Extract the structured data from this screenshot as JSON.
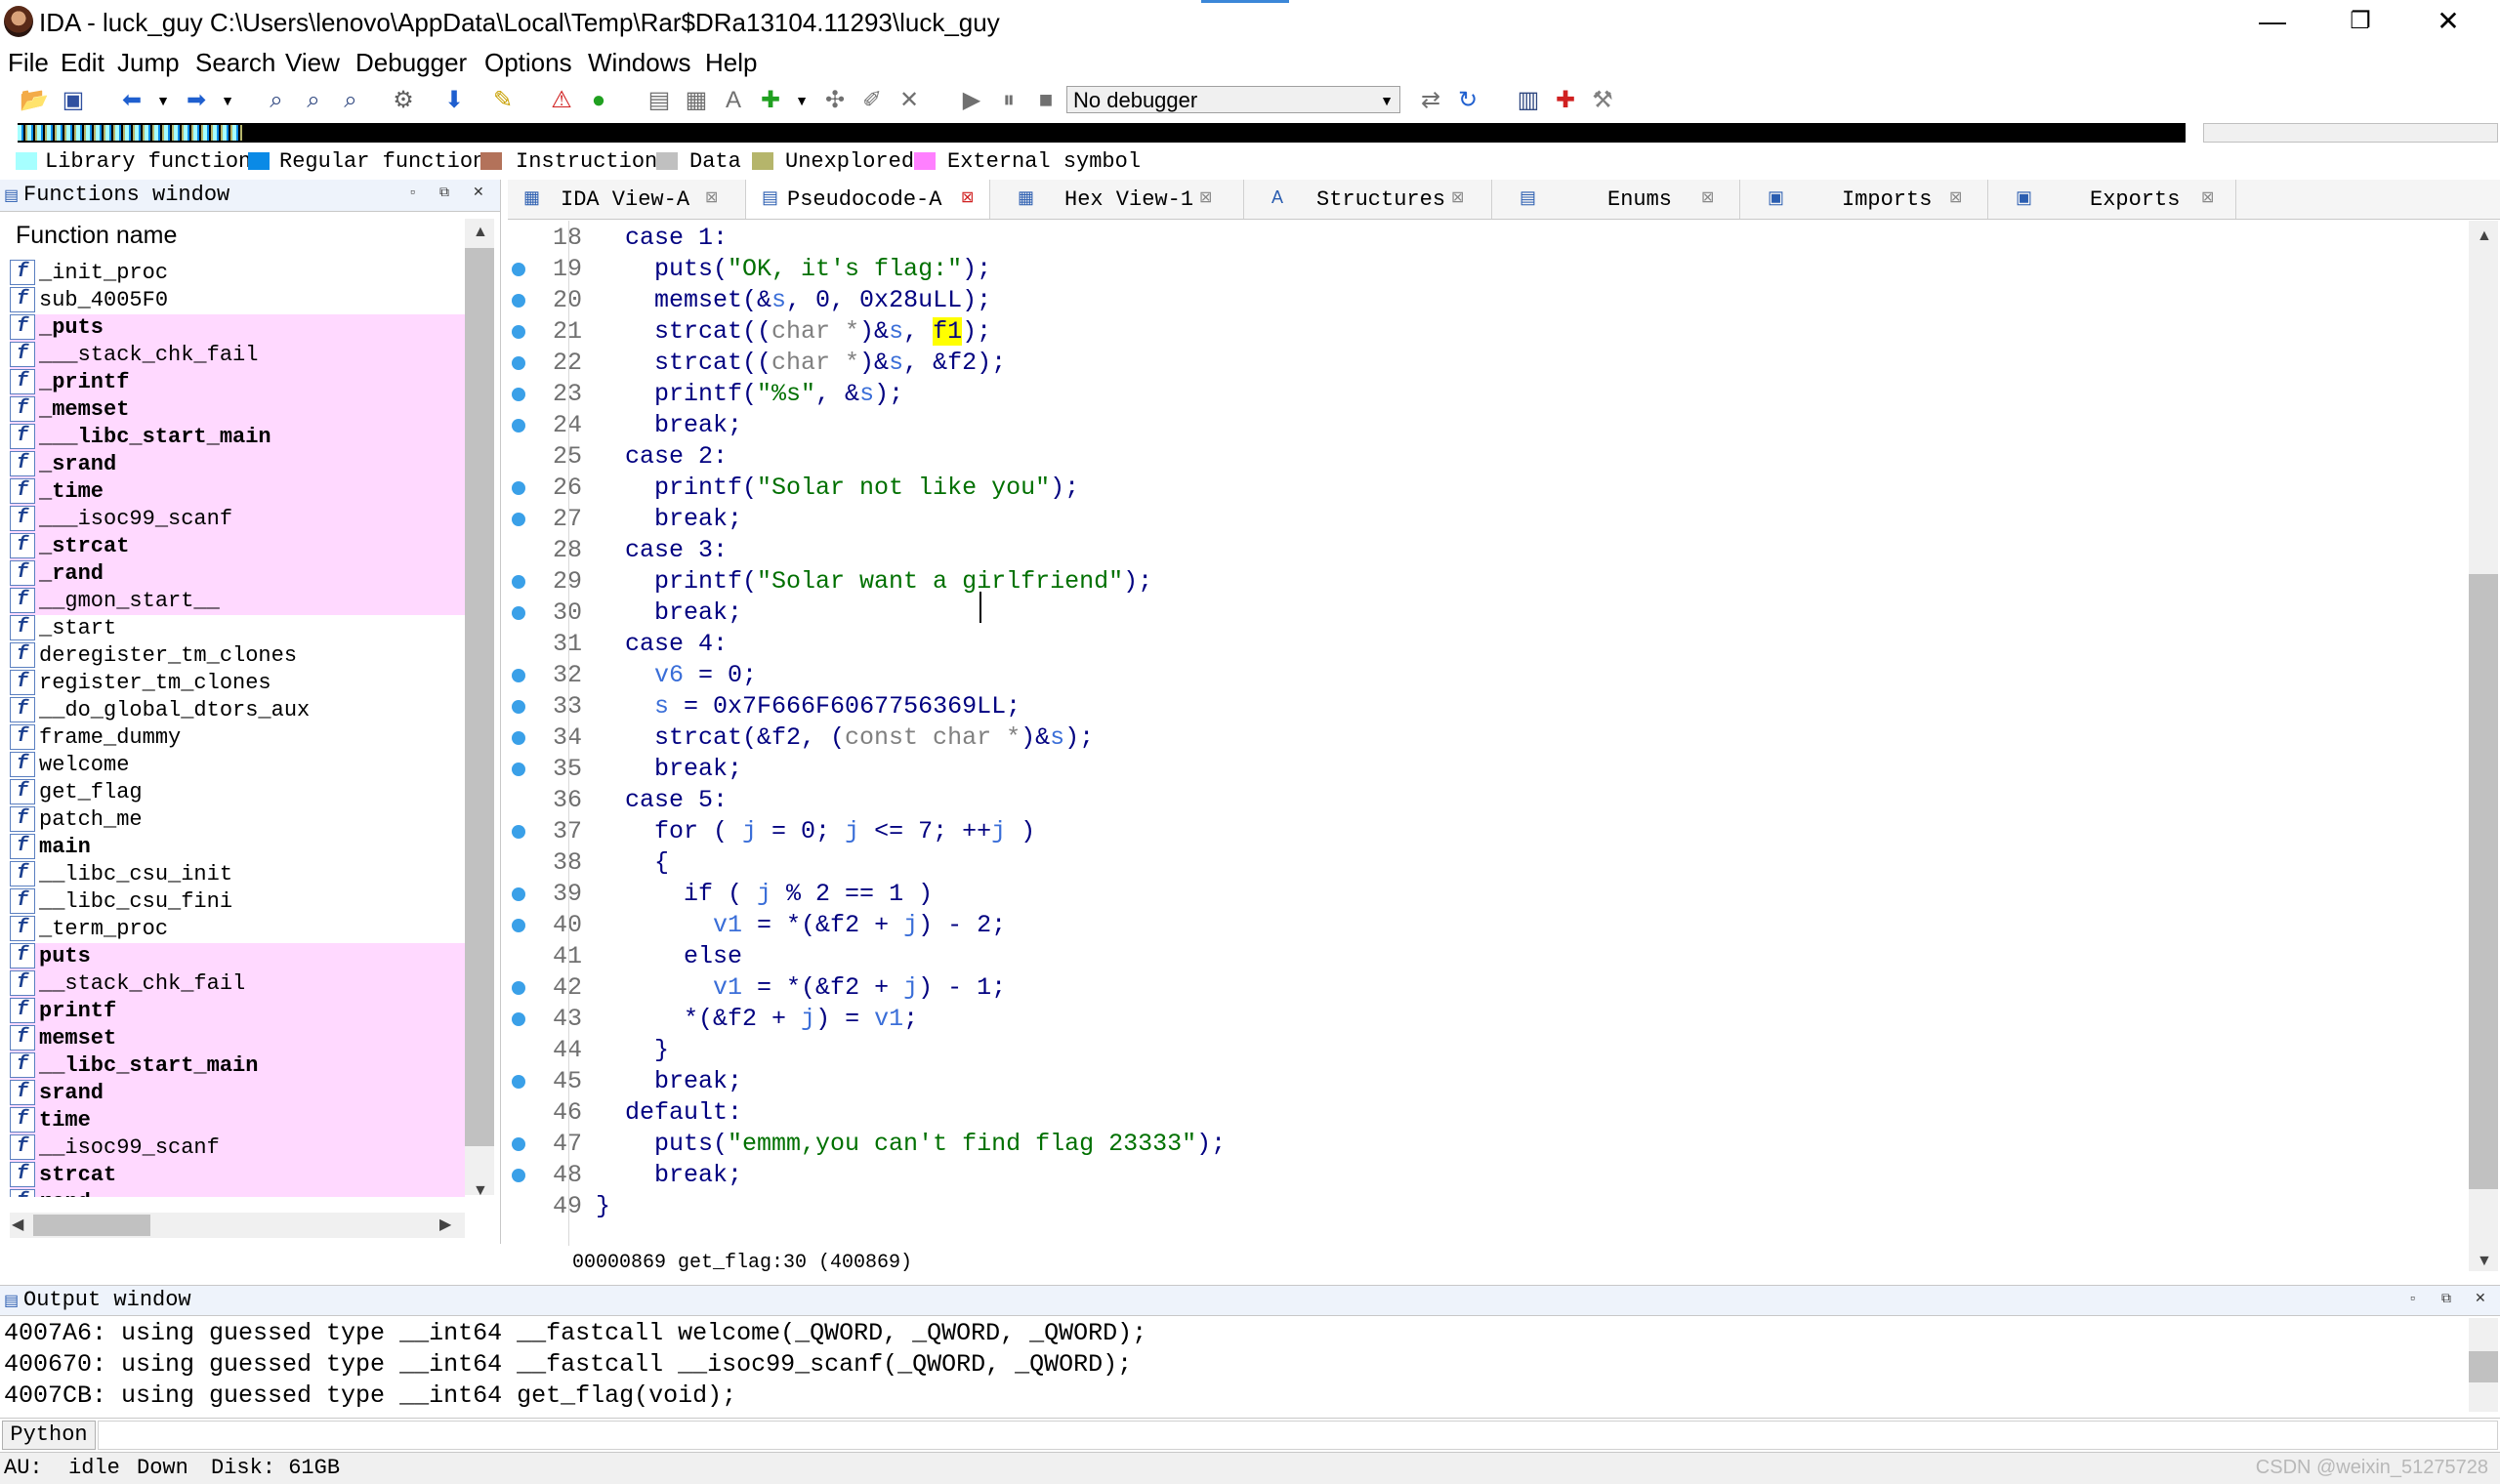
{
  "window": {
    "title": "IDA - luck_guy C:\\Users\\lenovo\\AppData\\Local\\Temp\\Rar$DRa13104.11293\\luck_guy",
    "minimize": "—",
    "maximize": "❐",
    "close": "✕"
  },
  "menu": [
    "File",
    "Edit",
    "Jump",
    "Search",
    "View",
    "Debugger",
    "Options",
    "Windows",
    "Help"
  ],
  "toolbar": {
    "debugger_select": "No debugger"
  },
  "legend": [
    {
      "label": "Library function",
      "color": "#a6ffff"
    },
    {
      "label": "Regular function",
      "color": "#0a8ae6"
    },
    {
      "label": "Instruction",
      "color": "#b3725a"
    },
    {
      "label": "Data",
      "color": "#c0c0c0"
    },
    {
      "label": "Unexplored",
      "color": "#b5b56b"
    },
    {
      "label": "External symbol",
      "color": "#ff80ff"
    }
  ],
  "functions_window": {
    "title": "Functions window",
    "header": "Function name",
    "items": [
      {
        "name": "_init_proc",
        "pink": false,
        "bold": false
      },
      {
        "name": "sub_4005F0",
        "pink": false,
        "bold": false
      },
      {
        "name": "_puts",
        "pink": true,
        "bold": true
      },
      {
        "name": "___stack_chk_fail",
        "pink": true,
        "bold": false
      },
      {
        "name": "_printf",
        "pink": true,
        "bold": true
      },
      {
        "name": "_memset",
        "pink": true,
        "bold": true
      },
      {
        "name": "___libc_start_main",
        "pink": true,
        "bold": true
      },
      {
        "name": "_srand",
        "pink": true,
        "bold": true
      },
      {
        "name": "_time",
        "pink": true,
        "bold": true
      },
      {
        "name": "___isoc99_scanf",
        "pink": true,
        "bold": false
      },
      {
        "name": "_strcat",
        "pink": true,
        "bold": true
      },
      {
        "name": "_rand",
        "pink": true,
        "bold": true
      },
      {
        "name": "__gmon_start__",
        "pink": true,
        "bold": false
      },
      {
        "name": "_start",
        "pink": false,
        "bold": false
      },
      {
        "name": "deregister_tm_clones",
        "pink": false,
        "bold": false
      },
      {
        "name": "register_tm_clones",
        "pink": false,
        "bold": false
      },
      {
        "name": "__do_global_dtors_aux",
        "pink": false,
        "bold": false
      },
      {
        "name": "frame_dummy",
        "pink": false,
        "bold": false
      },
      {
        "name": "welcome",
        "pink": false,
        "bold": false
      },
      {
        "name": "get_flag",
        "pink": false,
        "bold": false
      },
      {
        "name": "patch_me",
        "pink": false,
        "bold": false
      },
      {
        "name": "main",
        "pink": false,
        "bold": true
      },
      {
        "name": "__libc_csu_init",
        "pink": false,
        "bold": false
      },
      {
        "name": "__libc_csu_fini",
        "pink": false,
        "bold": false
      },
      {
        "name": "_term_proc",
        "pink": false,
        "bold": false
      },
      {
        "name": "puts",
        "pink": true,
        "bold": true
      },
      {
        "name": "__stack_chk_fail",
        "pink": true,
        "bold": false
      },
      {
        "name": "printf",
        "pink": true,
        "bold": true
      },
      {
        "name": "memset",
        "pink": true,
        "bold": true
      },
      {
        "name": "__libc_start_main",
        "pink": true,
        "bold": true
      },
      {
        "name": "srand",
        "pink": true,
        "bold": true
      },
      {
        "name": "time",
        "pink": true,
        "bold": true
      },
      {
        "name": "__isoc99_scanf",
        "pink": true,
        "bold": false
      },
      {
        "name": "strcat",
        "pink": true,
        "bold": true
      },
      {
        "name": "rand",
        "pink": true,
        "bold": true
      }
    ]
  },
  "tabs": [
    {
      "label": "IDA View-A",
      "active": false
    },
    {
      "label": "Pseudocode-A",
      "active": true
    },
    {
      "label": "Hex View-1",
      "active": false
    },
    {
      "label": "Structures",
      "active": false
    },
    {
      "label": "Enums",
      "active": false
    },
    {
      "label": "Imports",
      "active": false
    },
    {
      "label": "Exports",
      "active": false
    }
  ],
  "code": [
    {
      "n": "18",
      "bp": false,
      "html": "  case 1:"
    },
    {
      "n": "19",
      "bp": true,
      "html": "    puts(<span class=\"str\">\"OK, it's flag:\"</span>);"
    },
    {
      "n": "20",
      "bp": true,
      "html": "    memset(&amp;<span class=\"var\">s</span>, 0, 0x28uLL);"
    },
    {
      "n": "21",
      "bp": true,
      "html": "    strcat((<span class=\"cast\">char *</span>)&amp;<span class=\"var\">s</span>, <span class=\"hl\">f1</span>);"
    },
    {
      "n": "22",
      "bp": true,
      "html": "    strcat((<span class=\"cast\">char *</span>)&amp;<span class=\"var\">s</span>, &amp;f2);"
    },
    {
      "n": "23",
      "bp": true,
      "html": "    printf(<span class=\"str\">\"%s\"</span>, &amp;<span class=\"var\">s</span>);"
    },
    {
      "n": "24",
      "bp": true,
      "html": "    break;"
    },
    {
      "n": "25",
      "bp": false,
      "html": "  case 2:"
    },
    {
      "n": "26",
      "bp": true,
      "html": "    printf(<span class=\"str\">\"Solar not like you\"</span>);"
    },
    {
      "n": "27",
      "bp": true,
      "html": "    break;"
    },
    {
      "n": "28",
      "bp": false,
      "html": "  case 3:"
    },
    {
      "n": "29",
      "bp": true,
      "html": "    printf(<span class=\"str\">\"Solar want a girlfriend\"</span>);"
    },
    {
      "n": "30",
      "bp": true,
      "html": "    break;"
    },
    {
      "n": "31",
      "bp": false,
      "html": "  case 4:"
    },
    {
      "n": "32",
      "bp": true,
      "html": "    <span class=\"var\">v6</span> = 0;"
    },
    {
      "n": "33",
      "bp": true,
      "html": "    <span class=\"var\">s</span> = 0x7F666F6067756369LL;"
    },
    {
      "n": "34",
      "bp": true,
      "html": "    strcat(&amp;f2, (<span class=\"cast\">const char *</span>)&amp;<span class=\"var\">s</span>);"
    },
    {
      "n": "35",
      "bp": true,
      "html": "    break;"
    },
    {
      "n": "36",
      "bp": false,
      "html": "  case 5:"
    },
    {
      "n": "37",
      "bp": true,
      "html": "    for ( <span class=\"var\">j</span> = 0; <span class=\"var\">j</span> &lt;= 7; ++<span class=\"var\">j</span> )"
    },
    {
      "n": "38",
      "bp": false,
      "html": "    {"
    },
    {
      "n": "39",
      "bp": true,
      "html": "      if ( <span class=\"var\">j</span> % 2 == 1 )"
    },
    {
      "n": "40",
      "bp": true,
      "html": "        <span class=\"var\">v1</span> = *(&amp;f2 + <span class=\"var\">j</span>) - 2;"
    },
    {
      "n": "41",
      "bp": false,
      "html": "      else"
    },
    {
      "n": "42",
      "bp": true,
      "html": "        <span class=\"var\">v1</span> = *(&amp;f2 + <span class=\"var\">j</span>) - 1;"
    },
    {
      "n": "43",
      "bp": true,
      "html": "      *(&amp;f2 + <span class=\"var\">j</span>) = <span class=\"var\">v1</span>;"
    },
    {
      "n": "44",
      "bp": false,
      "html": "    }"
    },
    {
      "n": "45",
      "bp": true,
      "html": "    break;"
    },
    {
      "n": "46",
      "bp": false,
      "html": "  default:"
    },
    {
      "n": "47",
      "bp": true,
      "html": "    puts(<span class=\"str\">\"emmm,you can't find flag 23333\"</span>);"
    },
    {
      "n": "48",
      "bp": true,
      "html": "    break;"
    },
    {
      "n": "49",
      "bp": false,
      "html": "}"
    }
  ],
  "code_status": "00000869 get_flag:30 (400869)",
  "output_window": {
    "title": "Output window",
    "lines": [
      "4007A6: using guessed type __int64 __fastcall welcome(_QWORD, _QWORD, _QWORD);",
      "400670: using guessed type __int64 __fastcall __isoc99_scanf(_QWORD, _QWORD);",
      "4007CB: using guessed type __int64 get_flag(void);"
    ]
  },
  "python_button": "Python",
  "status": {
    "au": "AU:  idle",
    "dir": "Down",
    "disk": "Disk: 61GB"
  },
  "watermark": "CSDN @weixin_51275728"
}
